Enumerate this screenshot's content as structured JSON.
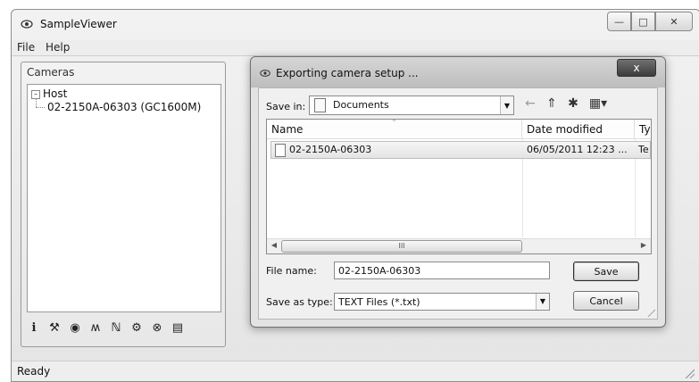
{
  "app": {
    "title": "SampleViewer",
    "title_icon": "eye-icon",
    "window_buttons": {
      "minimize": "—",
      "maximize": "□",
      "close": "✕"
    }
  },
  "menu": {
    "items": [
      "File",
      "Help"
    ]
  },
  "cameras_panel": {
    "title": "Cameras",
    "tree": {
      "host": {
        "expander": "–",
        "label": "Host"
      },
      "camera": "02-2150A-06303 (GC1600M)"
    },
    "toolbar": {
      "icons": [
        "info-icon",
        "wrench-icon",
        "eye-icon",
        "waveform-icon",
        "register-icon",
        "film-icon",
        "settings-icon",
        "save-icon"
      ],
      "glyphs": [
        "i",
        "⚒",
        "◉",
        "ʍ",
        "ℕ",
        "⚙",
        "⊗",
        "▤"
      ]
    }
  },
  "status": {
    "text": "Ready"
  },
  "dialog": {
    "title": "Exporting camera setup ...",
    "close_glyph": "x",
    "save_in_label": "Save in:",
    "save_in_value": "Documents",
    "combo_arrow": "▼",
    "nav_glyphs": {
      "back": "←",
      "up": "⇑",
      "new_folder": "✱",
      "views": "▦▾"
    },
    "columns": [
      "Name",
      "Date modified",
      "Ty"
    ],
    "sort_indicator": "˄",
    "files": [
      {
        "name": "02-2150A-06303",
        "date": "06/05/2011 12:23 ...",
        "type": "Te"
      }
    ],
    "scrollbar": {
      "left": "◀",
      "right": "▶",
      "thumb": "III"
    },
    "file_name_label": "File name:",
    "file_name_value": "02-2150A-06303",
    "save_as_type_label": "Save as type:",
    "save_as_type_value": "TEXT Files (*.txt)",
    "save_button": "Save",
    "cancel_button": "Cancel"
  }
}
